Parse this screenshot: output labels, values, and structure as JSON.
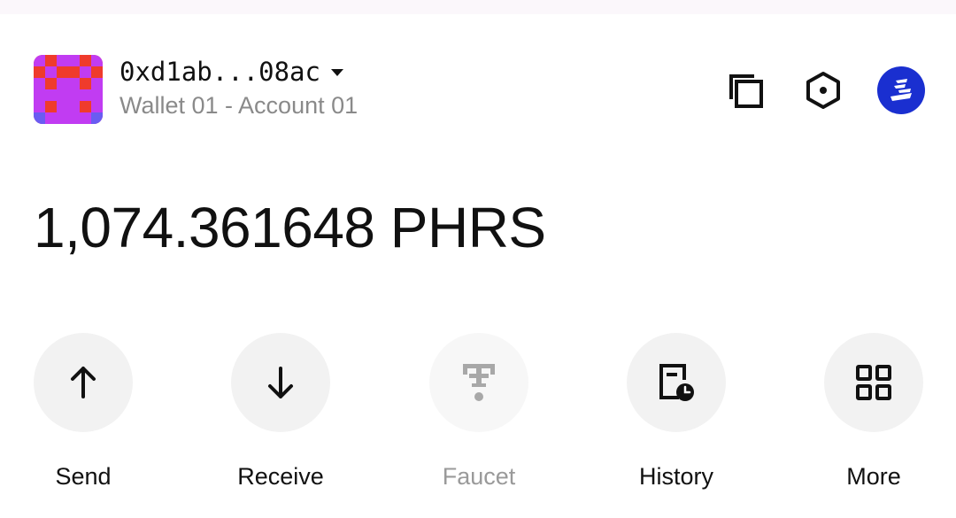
{
  "account": {
    "address": "0xd1ab...08ac",
    "name": "Wallet 01 - Account 01"
  },
  "icons": {
    "avatar": "identicon-avatar",
    "copy": "copy-icon",
    "settings": "hexagon-settings-icon",
    "network": "network-logo-icon",
    "dropdown": "chevron-down-icon"
  },
  "balance": {
    "text": "1,074.361648 PHRS"
  },
  "actions": [
    {
      "label": "Send",
      "icon": "arrow-up-icon",
      "enabled": true
    },
    {
      "label": "Receive",
      "icon": "arrow-down-icon",
      "enabled": true
    },
    {
      "label": "Faucet",
      "icon": "faucet-icon",
      "enabled": false
    },
    {
      "label": "History",
      "icon": "history-icon",
      "enabled": true
    },
    {
      "label": "More",
      "icon": "grid-icon",
      "enabled": true
    }
  ],
  "colors": {
    "network_logo": "#1a2fd0",
    "avatar_red": "#ef3b2c",
    "avatar_magenta": "#c13cf2",
    "avatar_blue": "#6a5cf2"
  }
}
